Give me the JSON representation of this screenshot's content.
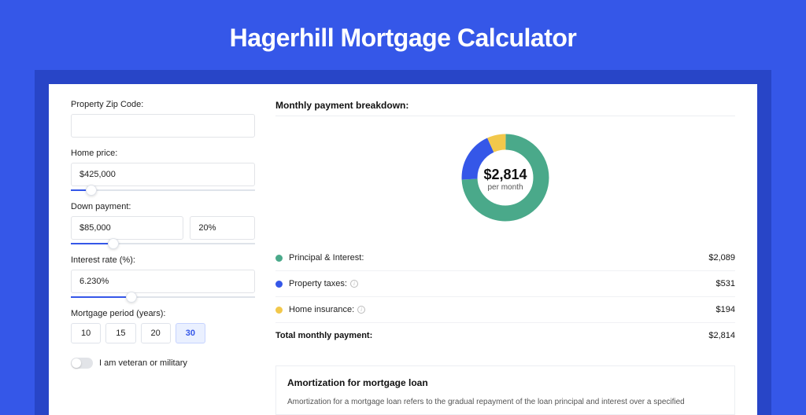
{
  "title": "Hagerhill Mortgage Calculator",
  "form": {
    "zip": {
      "label": "Property Zip Code:",
      "value": ""
    },
    "home_price": {
      "label": "Home price:",
      "value": "$425,000",
      "slider_pct": 8
    },
    "down_payment": {
      "label": "Down payment:",
      "amount": "$85,000",
      "pct": "20%",
      "slider_pct": 20
    },
    "interest": {
      "label": "Interest rate (%):",
      "value": "6.230%",
      "slider_pct": 30
    },
    "period": {
      "label": "Mortgage period (years):",
      "options": [
        "10",
        "15",
        "20",
        "30"
      ],
      "selected": "30"
    },
    "veteran": {
      "label": "I am veteran or military",
      "on": false
    }
  },
  "breakdown": {
    "title": "Monthly payment breakdown:",
    "center_amount": "$2,814",
    "center_sub": "per month",
    "items": [
      {
        "label": "Principal & Interest:",
        "value": "$2,089",
        "color": "#4aa98a",
        "info": false
      },
      {
        "label": "Property taxes:",
        "value": "$531",
        "color": "#3557e8",
        "info": true
      },
      {
        "label": "Home insurance:",
        "value": "$194",
        "color": "#f2c84b",
        "info": true
      }
    ],
    "total_label": "Total monthly payment:",
    "total_value": "$2,814"
  },
  "chart_data": {
    "type": "pie",
    "title": "Monthly payment breakdown",
    "series": [
      {
        "name": "Principal & Interest",
        "value": 2089,
        "color": "#4aa98a"
      },
      {
        "name": "Property taxes",
        "value": 531,
        "color": "#3557e8"
      },
      {
        "name": "Home insurance",
        "value": 194,
        "color": "#f2c84b"
      }
    ],
    "total": 2814,
    "unit": "USD per month"
  },
  "amort": {
    "title": "Amortization for mortgage loan",
    "text": "Amortization for a mortgage loan refers to the gradual repayment of the loan principal and interest over a specified"
  }
}
